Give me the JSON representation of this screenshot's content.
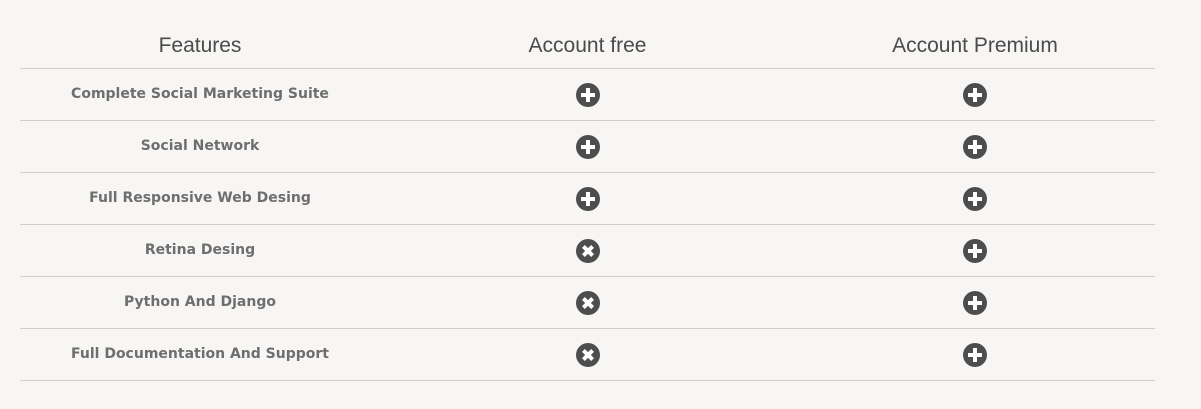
{
  "header": {
    "features": "Features",
    "free": "Account free",
    "premium": "Account Premium"
  },
  "rows": [
    {
      "feature": "Complete Social Marketing Suite",
      "free": "plus-icon",
      "premium": "plus-icon"
    },
    {
      "feature": "Social Network",
      "free": "plus-icon",
      "premium": "plus-icon"
    },
    {
      "feature": "Full Responsive Web Desing",
      "free": "plus-icon",
      "premium": "plus-icon"
    },
    {
      "feature": "Retina Desing",
      "free": "cross-icon",
      "premium": "plus-icon"
    },
    {
      "feature": "Python And Django",
      "free": "cross-icon",
      "premium": "plus-icon"
    },
    {
      "feature": "Full Documentation And Support",
      "free": "cross-icon",
      "premium": "plus-icon"
    }
  ],
  "colors": {
    "background": "#f7f6f4",
    "icon": "#4d4d4d",
    "divider": "#cfcfcf"
  }
}
